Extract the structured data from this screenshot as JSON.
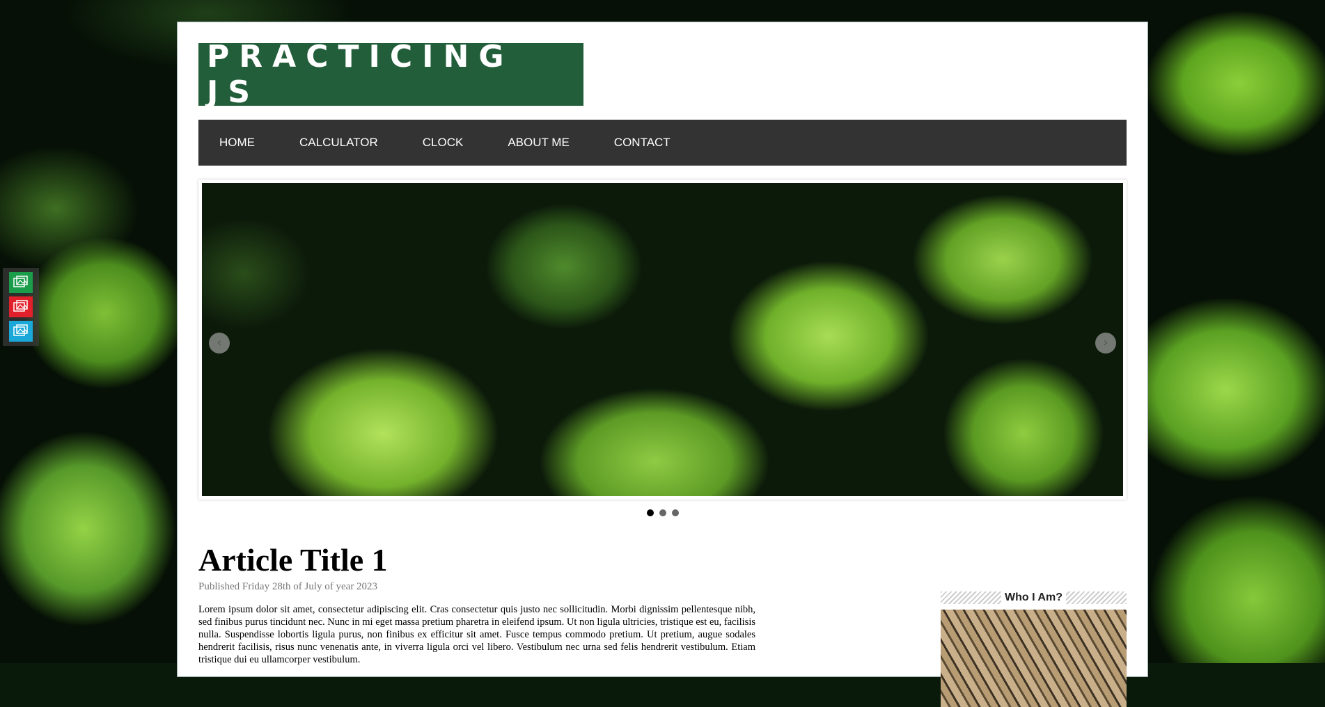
{
  "site": {
    "logo": "PRACTICING JS"
  },
  "nav": {
    "items": [
      {
        "label": "HOME"
      },
      {
        "label": "CALCULATOR"
      },
      {
        "label": "CLOCK"
      },
      {
        "label": "ABOUT ME"
      },
      {
        "label": "CONTACT"
      }
    ]
  },
  "slider": {
    "prev_icon": "chevron-left-icon",
    "next_icon": "chevron-right-icon",
    "slide_count": 3,
    "active_slide": 1
  },
  "article": {
    "title": "Article Title 1",
    "meta": "Published Friday 28th of July of year 2023",
    "body": "Lorem ipsum dolor sit amet, consectetur adipiscing elit. Cras consectetur quis justo nec sollicitudin. Morbi dignissim pellentesque nibh, sed finibus purus tincidunt nec. Nunc in mi eget massa pretium pharetra in eleifend ipsum. Ut non ligula ultricies, tristique est eu, facilisis nulla. Suspendisse lobortis ligula purus, non finibus ex efficitur sit amet. Fusce tempus commodo pretium. Ut pretium, augue sodales hendrerit facilisis, risus nunc venenatis ante, in viverra ligula orci vel libero. Vestibulum nec urna sed felis hendrerit vestibulum. Etiam tristique dui eu ullamcorper vestibulum."
  },
  "sidebar": {
    "widget_title": "Who I Am?"
  },
  "side_icons": [
    {
      "name": "image-icon-green",
      "color": "#1a9c4a"
    },
    {
      "name": "image-icon-red",
      "color": "#e0202a"
    },
    {
      "name": "image-icon-blue",
      "color": "#1aa8d8"
    }
  ]
}
